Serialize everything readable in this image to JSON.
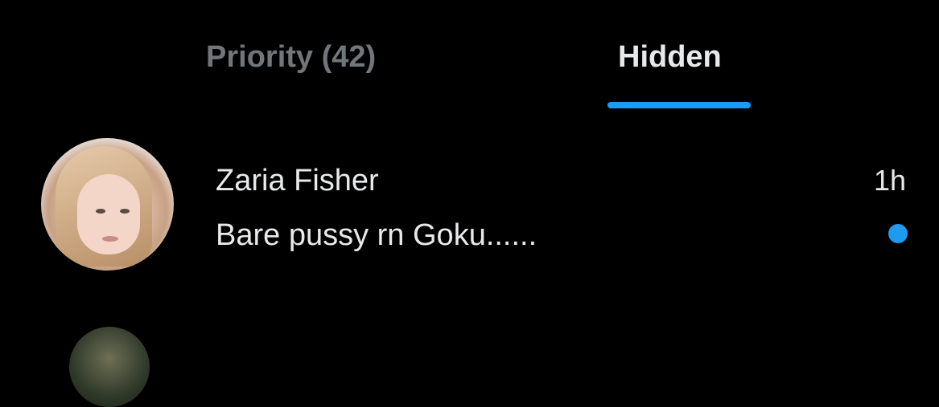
{
  "tabs": [
    {
      "label": "Priority (42)",
      "active": false
    },
    {
      "label": "Hidden",
      "active": true
    }
  ],
  "colors": {
    "background": "#000000",
    "accent": "#1d9bf0",
    "text_primary": "#e7e9ea",
    "text_muted": "#71767b"
  },
  "conversations": [
    {
      "name": "Zaria Fisher",
      "preview": "Bare pussy rn Goku......",
      "time": "1h",
      "unread": true,
      "avatar_icon": "user-avatar"
    }
  ]
}
